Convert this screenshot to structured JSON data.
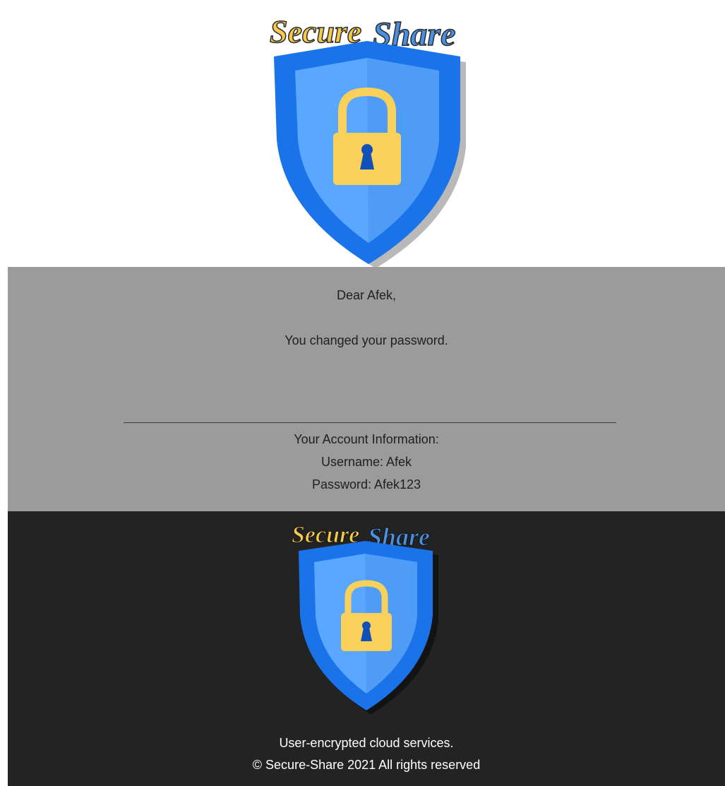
{
  "brand": {
    "logo_text": "SecureShare",
    "colors": {
      "shield_outer": "#1a73e8",
      "shield_inner": "#5aa7ff",
      "lock_body": "#f9d15a",
      "keyhole": "#1150b8",
      "text_yellow": "#f6c94b",
      "text_blue": "#4a90e2"
    }
  },
  "email": {
    "greeting": "Dear Afek,",
    "message": "You changed your password.",
    "account_heading": "Your Account Information:",
    "username_line": "Username: Afek",
    "password_line": "Password: Afek123"
  },
  "footer": {
    "tagline": "User-encrypted cloud services.",
    "copyright": "© Secure-Share 2021 All rights reserved"
  }
}
